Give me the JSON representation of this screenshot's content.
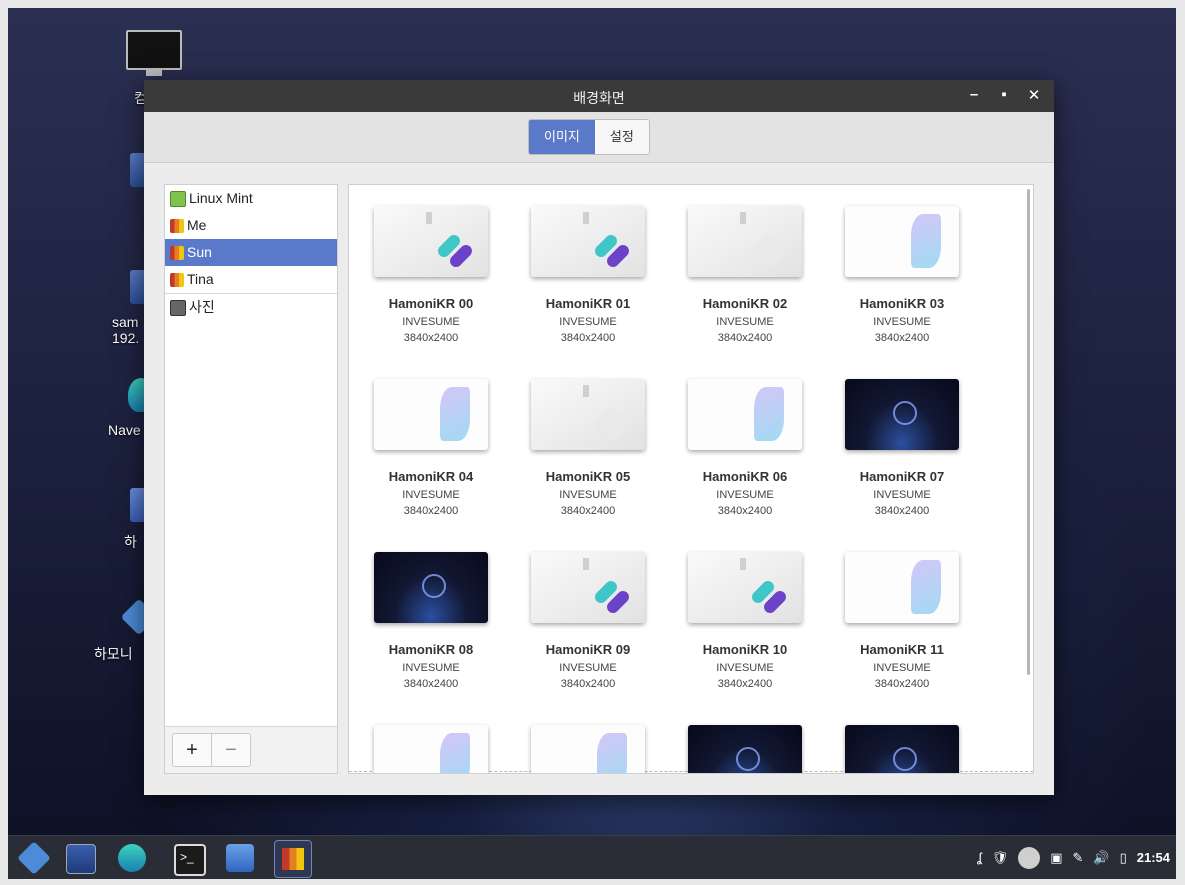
{
  "window": {
    "title": "배경화면"
  },
  "tabs": {
    "images": "이미지",
    "settings": "설정"
  },
  "sidebar": {
    "items": [
      {
        "label": "Linux Mint"
      },
      {
        "label": "Me"
      },
      {
        "label": "Sun"
      },
      {
        "label": "Tina"
      },
      {
        "label": "사진"
      }
    ],
    "add_label": "+",
    "remove_label": "−"
  },
  "wallpapers": [
    {
      "name": "HamoniKR 00",
      "author": "INVESUME",
      "size": "3840x2400"
    },
    {
      "name": "HamoniKR 01",
      "author": "INVESUME",
      "size": "3840x2400"
    },
    {
      "name": "HamoniKR 02",
      "author": "INVESUME",
      "size": "3840x2400"
    },
    {
      "name": "HamoniKR 03",
      "author": "INVESUME",
      "size": "3840x2400"
    },
    {
      "name": "HamoniKR 04",
      "author": "INVESUME",
      "size": "3840x2400"
    },
    {
      "name": "HamoniKR 05",
      "author": "INVESUME",
      "size": "3840x2400"
    },
    {
      "name": "HamoniKR 06",
      "author": "INVESUME",
      "size": "3840x2400"
    },
    {
      "name": "HamoniKR 07",
      "author": "INVESUME",
      "size": "3840x2400"
    },
    {
      "name": "HamoniKR 08",
      "author": "INVESUME",
      "size": "3840x2400"
    },
    {
      "name": "HamoniKR 09",
      "author": "INVESUME",
      "size": "3840x2400"
    },
    {
      "name": "HamoniKR 10",
      "author": "INVESUME",
      "size": "3840x2400"
    },
    {
      "name": "HamoniKR 11",
      "author": "INVESUME",
      "size": "3840x2400"
    }
  ],
  "desktop": {
    "icons": [
      "컴",
      "sam",
      "192.",
      "Nave",
      "하",
      "하모니"
    ]
  },
  "taskbar": {
    "clock": "21:54"
  },
  "colors": {
    "accent": "#5b79c9",
    "titlebar": "#3a3a3a"
  }
}
